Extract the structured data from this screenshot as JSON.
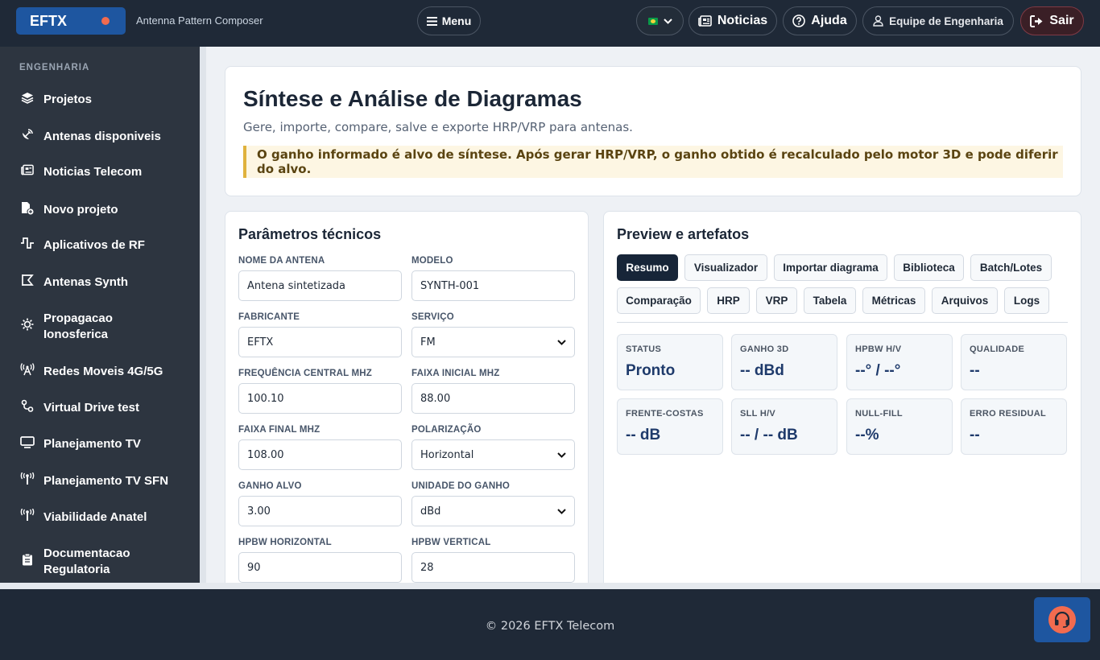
{
  "header": {
    "brand": "EFTX",
    "app_subtitle": "Antenna Pattern Composer",
    "menu_label": "Menu",
    "news_label": "Noticias",
    "help_label": "Ajuda",
    "team_label": "Equipe de Engenharia",
    "exit_label": "Sair"
  },
  "sidebar": {
    "heading": "ENGENHARIA",
    "items": [
      {
        "label": "Projetos",
        "icon": "layers-icon"
      },
      {
        "label": "Antenas disponiveis",
        "icon": "satellite-dish-icon"
      },
      {
        "label": "Noticias Telecom",
        "icon": "newspaper-icon"
      },
      {
        "label": "Novo projeto",
        "icon": "file-plus-icon"
      },
      {
        "label": "Aplicativos de RF",
        "icon": "waveform-icon"
      },
      {
        "label": "Antenas Synth",
        "icon": "synth-icon"
      },
      {
        "label": "Propagacao Ionosferica",
        "icon": "sun-icon"
      },
      {
        "label": "Redes Moveis 4G/5G",
        "icon": "tower-icon"
      },
      {
        "label": "Virtual Drive test",
        "icon": "route-icon"
      },
      {
        "label": "Planejamento TV",
        "icon": "monitor-icon"
      },
      {
        "label": "Planejamento TV SFN",
        "icon": "broadcast-icon"
      },
      {
        "label": "Viabilidade Anatel",
        "icon": "broadcast-icon"
      },
      {
        "label": "Documentacao Regulatoria",
        "icon": "clipboard-icon"
      }
    ]
  },
  "hero": {
    "title": "Síntese e Análise de Diagramas",
    "subtitle": "Gere, importe, compare, salve e exporte HRP/VRP para antenas.",
    "alert": "O ganho informado é alvo de síntese. Após gerar HRP/VRP, o ganho obtido é recalculado pelo motor 3D e pode diferir do alvo."
  },
  "params": {
    "title": "Parâmetros técnicos",
    "fields": [
      {
        "label": "NOME DA ANTENA",
        "value": "Antena sintetizada"
      },
      {
        "label": "MODELO",
        "value": "SYNTH-001"
      },
      {
        "label": "FABRICANTE",
        "value": "EFTX"
      },
      {
        "label": "SERVIÇO",
        "value": "FM"
      },
      {
        "label": "FREQUÊNCIA CENTRAL MHZ",
        "value": "100.10"
      },
      {
        "label": "FAIXA INICIAL MHZ",
        "value": "88.00"
      },
      {
        "label": "FAIXA FINAL MHZ",
        "value": "108.00"
      },
      {
        "label": "POLARIZAÇÃO",
        "value": "Horizontal"
      },
      {
        "label": "GANHO ALVO",
        "value": "3.00"
      },
      {
        "label": "UNIDADE DO GANHO",
        "value": "dBd"
      },
      {
        "label": "HPBW HORIZONTAL",
        "value": "90"
      },
      {
        "label": "HPBW VERTICAL",
        "value": "28"
      }
    ]
  },
  "preview": {
    "title": "Preview e artefatos",
    "tabs": [
      "Resumo",
      "Visualizador",
      "Importar diagrama",
      "Biblioteca",
      "Batch/Lotes",
      "Comparação",
      "HRP",
      "VRP",
      "Tabela",
      "Métricas",
      "Arquivos",
      "Logs"
    ],
    "metrics": [
      {
        "label": "STATUS",
        "value": "Pronto"
      },
      {
        "label": "GANHO 3D",
        "value": "-- dBd"
      },
      {
        "label": "HPBW H/V",
        "value": "--° / --°"
      },
      {
        "label": "QUALIDADE",
        "value": "--"
      },
      {
        "label": "FRENTE-COSTAS",
        "value": "-- dB"
      },
      {
        "label": "SLL H/V",
        "value": "-- / -- dB"
      },
      {
        "label": "NULL-FILL",
        "value": "--%"
      },
      {
        "label": "ERRO RESIDUAL",
        "value": "--"
      }
    ]
  },
  "footer": {
    "text": "© 2026 EFTX Telecom"
  },
  "colors": {
    "brand": "#1e56a0",
    "accent": "#f26b4f",
    "dark": "#1f2937"
  }
}
